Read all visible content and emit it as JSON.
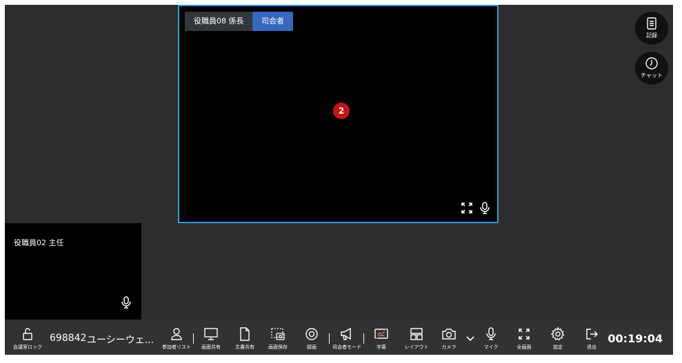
{
  "main_tile": {
    "participant_name": "役職員08 係長",
    "host_badge": "司会者",
    "participant_count": "2"
  },
  "small_tile": {
    "participant_name": "役職員02 主任"
  },
  "side": {
    "record_label": "記録",
    "chat_label": "チャット"
  },
  "toolbar": {
    "lock_label": "会議室ロック",
    "meeting_id": "698842",
    "meeting_name": "ユーシーウェ...",
    "participants_label": "参加者リスト",
    "screen_share_label": "画面共有",
    "doc_share_label": "文書共有",
    "screenshot_label": "画面保存",
    "record_label": "録画",
    "host_mode_label": "司会者モード",
    "caption_label": "字幕",
    "layout_label": "レイアウト",
    "camera_label": "カメラ",
    "mic_label": "マイク",
    "fullscreen_label": "全画面",
    "settings_label": "設定",
    "exit_label": "退出",
    "timer": "00:19:04"
  },
  "colors": {
    "highlight_border": "#2a9fd8",
    "host_badge": "#3866c0",
    "count_badge": "#c41414"
  }
}
